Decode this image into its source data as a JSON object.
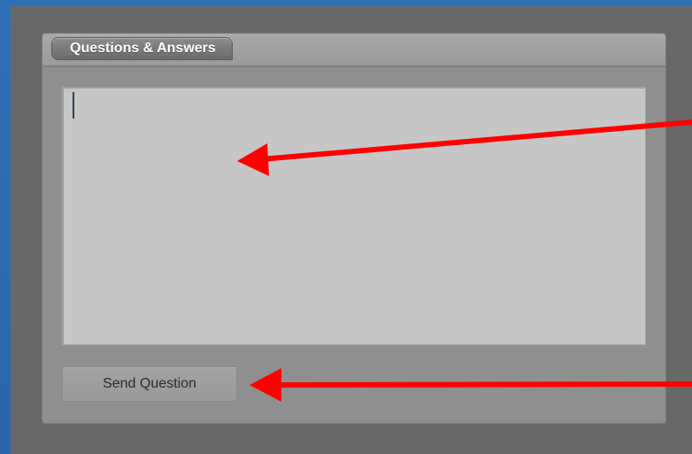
{
  "panel": {
    "title": "Questions & Answers",
    "question_input": {
      "value": "",
      "placeholder": ""
    },
    "send_button_label": "Send Question"
  },
  "annotations": [
    {
      "name": "arrow-to-input",
      "color": "#ff0000"
    },
    {
      "name": "arrow-to-send-button",
      "color": "#ff0000"
    }
  ]
}
